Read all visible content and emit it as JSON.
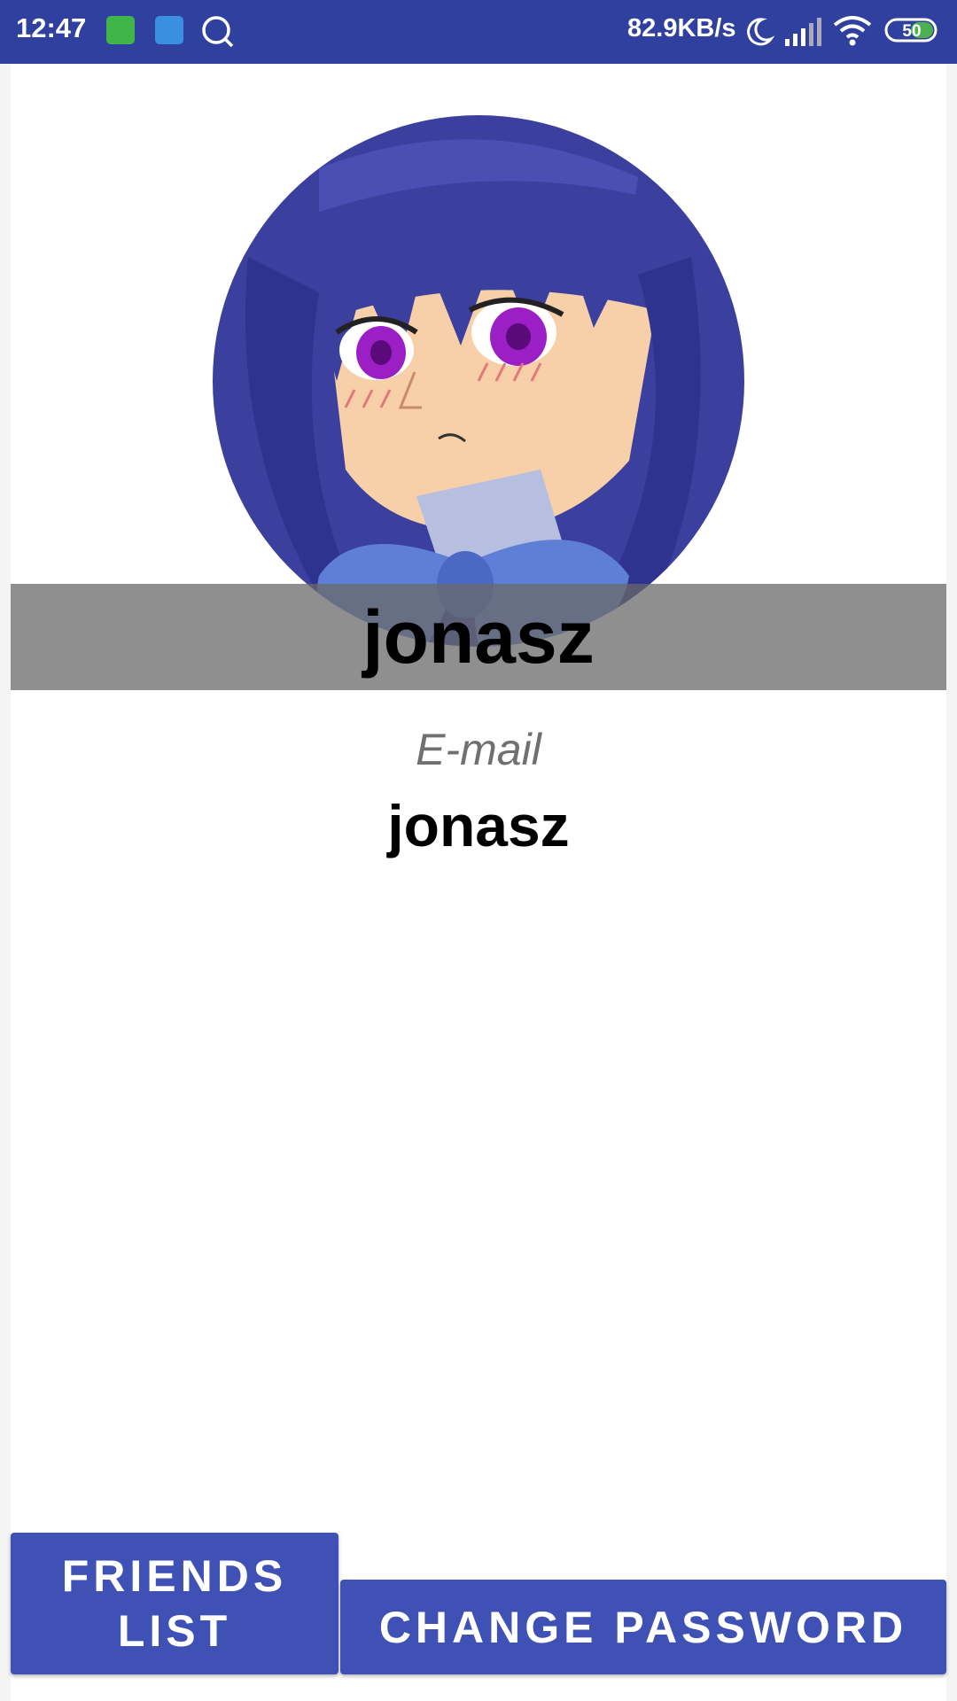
{
  "status_bar": {
    "time": "12:47",
    "network_speed": "82.9KB/s",
    "battery": "50",
    "icons": [
      "app-cat-icon",
      "cloud-app-icon",
      "search-icon",
      "moon-icon",
      "signal-icon",
      "wifi-icon",
      "battery-icon"
    ]
  },
  "profile": {
    "username": "jonasz",
    "email_label": "E-mail",
    "email_value": "jonasz"
  },
  "buttons": {
    "friends_list": "FRIENDS LIST",
    "change_password": "CHANGE PASSWORD"
  },
  "colors": {
    "status_bar": "#30409f",
    "button": "#3f51b5",
    "name_banner": "#8f8f8f"
  }
}
